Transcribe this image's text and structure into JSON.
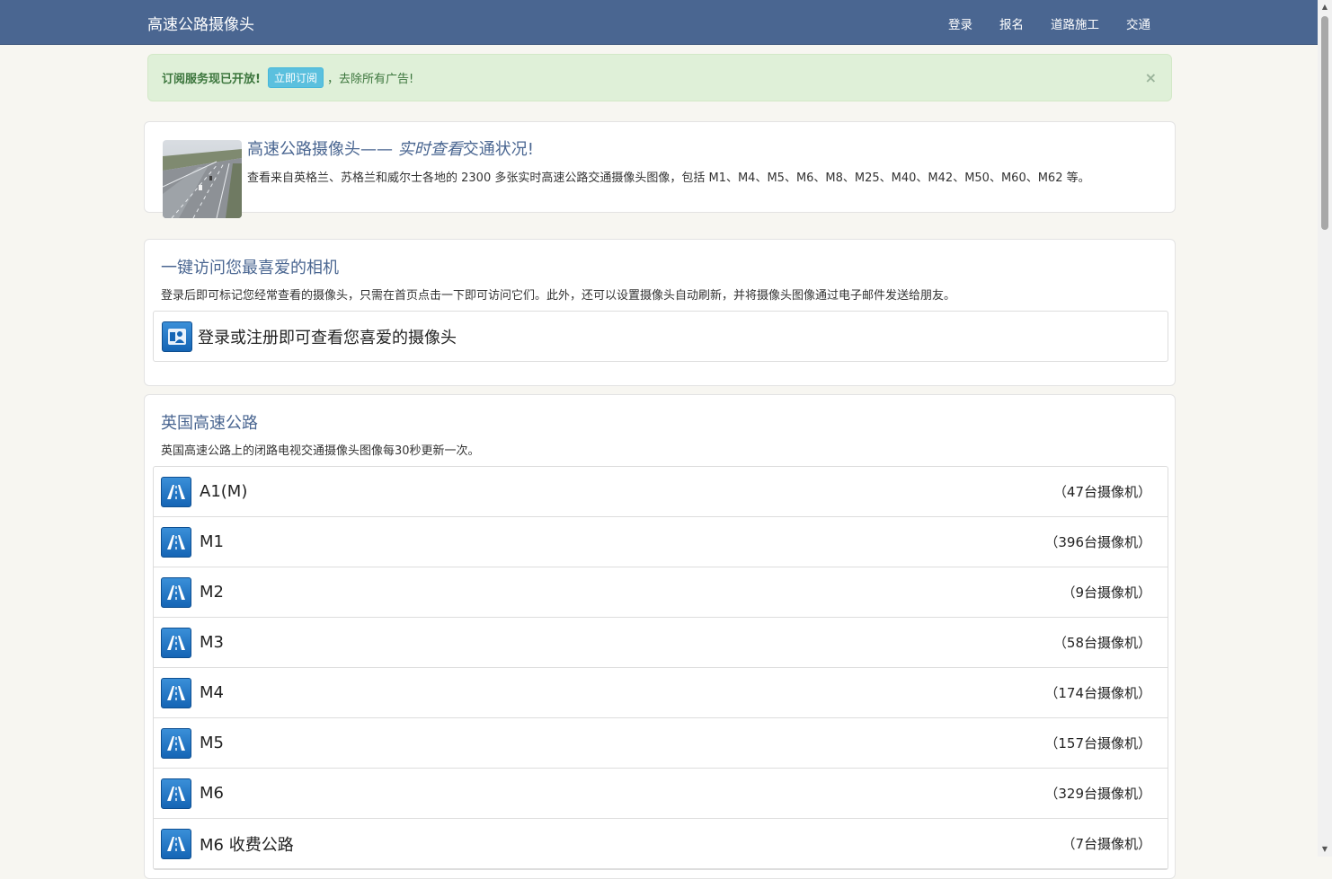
{
  "nav": {
    "brand": "高速公路摄像头",
    "links": [
      "登录",
      "报名",
      "道路施工",
      "交通"
    ]
  },
  "alert": {
    "strong": "订阅服务现已开放!",
    "button": "立即订阅",
    "text": "，去除所有广告!",
    "close": "×"
  },
  "hero": {
    "title_pre": "高速公路摄像头—— ",
    "title_em": "实时查看",
    "title_post": "交通状况!",
    "description": "查看来自英格兰、苏格兰和威尔士各地的 2300 多张实时高速公路交通摄像头图像，包括 M1、M4、M5、M6、M8、M25、M40、M42、M50、M60、M62 等。"
  },
  "favorites": {
    "title": "一键访问您最喜爱的相机",
    "description": "登录后即可标记您经常查看的摄像头，只需在首页点击一下即可访问它们。此外，还可以设置摄像头自动刷新，并将摄像头图像通过电子邮件发送给朋友。",
    "login_prompt": "登录或注册即可查看您喜爱的摄像头"
  },
  "motorways": {
    "title": "英国高速公路",
    "description": "英国高速公路上的闭路电视交通摄像头图像每30秒更新一次。",
    "items": [
      {
        "name": "A1(M)",
        "count": "（47台摄像机）"
      },
      {
        "name": "M1",
        "count": "（396台摄像机）"
      },
      {
        "name": "M2",
        "count": "（9台摄像机）"
      },
      {
        "name": "M3",
        "count": "（58台摄像机）"
      },
      {
        "name": "M4",
        "count": "（174台摄像机）"
      },
      {
        "name": "M5",
        "count": "（157台摄像机）"
      },
      {
        "name": "M6",
        "count": "（329台摄像机）"
      },
      {
        "name": "M6 收费公路",
        "count": "（7台摄像机）"
      }
    ]
  },
  "colors": {
    "navbar": "#4a6691",
    "alert_bg": "#dff0d8",
    "alert_button": "#5bc0de",
    "title_blue": "#4a6691"
  },
  "icons": {
    "road": "motorway-road-icon",
    "login": "user-login-icon"
  }
}
